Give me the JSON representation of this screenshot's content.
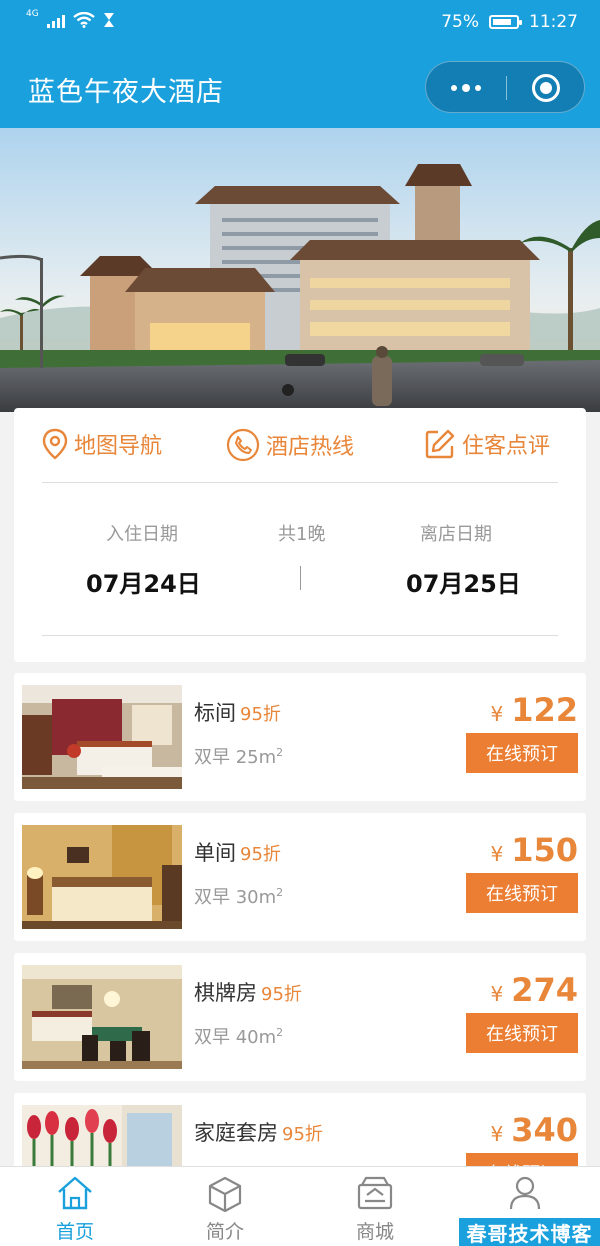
{
  "status_bar": {
    "network": "4G",
    "battery": "75%",
    "time": "11:27"
  },
  "navbar": {
    "title": "蓝色午夜大酒店"
  },
  "quick_actions": [
    {
      "label": "地图导航",
      "icon": "location-pin-icon"
    },
    {
      "label": "酒店热线",
      "icon": "phone-icon"
    },
    {
      "label": "住客点评",
      "icon": "edit-icon"
    }
  ],
  "booking": {
    "checkin_label": "入住日期",
    "nights_label": "共1晚",
    "checkout_label": "离店日期",
    "checkin_date": "07月24日",
    "checkout_date": "07月25日"
  },
  "rooms": [
    {
      "name": "标间",
      "discount": "95折",
      "spec": "双早 25m",
      "currency": "¥",
      "price": "122",
      "button": "在线预订"
    },
    {
      "name": "单间",
      "discount": "95折",
      "spec": "双早 30m",
      "currency": "¥",
      "price": "150",
      "button": "在线预订"
    },
    {
      "name": "棋牌房",
      "discount": "95折",
      "spec": "双早 40m",
      "currency": "¥",
      "price": "274",
      "button": "在线预订"
    },
    {
      "name": "家庭套房",
      "discount": "95折",
      "spec": "",
      "currency": "¥",
      "price": "340",
      "button": "在线预订"
    }
  ],
  "spec_unit_sup": "2",
  "tabs": [
    {
      "label": "首页",
      "icon": "home-icon",
      "active": true
    },
    {
      "label": "简介",
      "icon": "cube-icon",
      "active": false
    },
    {
      "label": "商城",
      "icon": "shop-icon",
      "active": false
    },
    {
      "label": "",
      "icon": "user-icon",
      "active": false
    }
  ],
  "watermark": "春哥技术博客",
  "colors": {
    "brand_blue": "#1aa0dc",
    "accent_orange": "#ec7e33",
    "text_orange": "#e8863a"
  }
}
